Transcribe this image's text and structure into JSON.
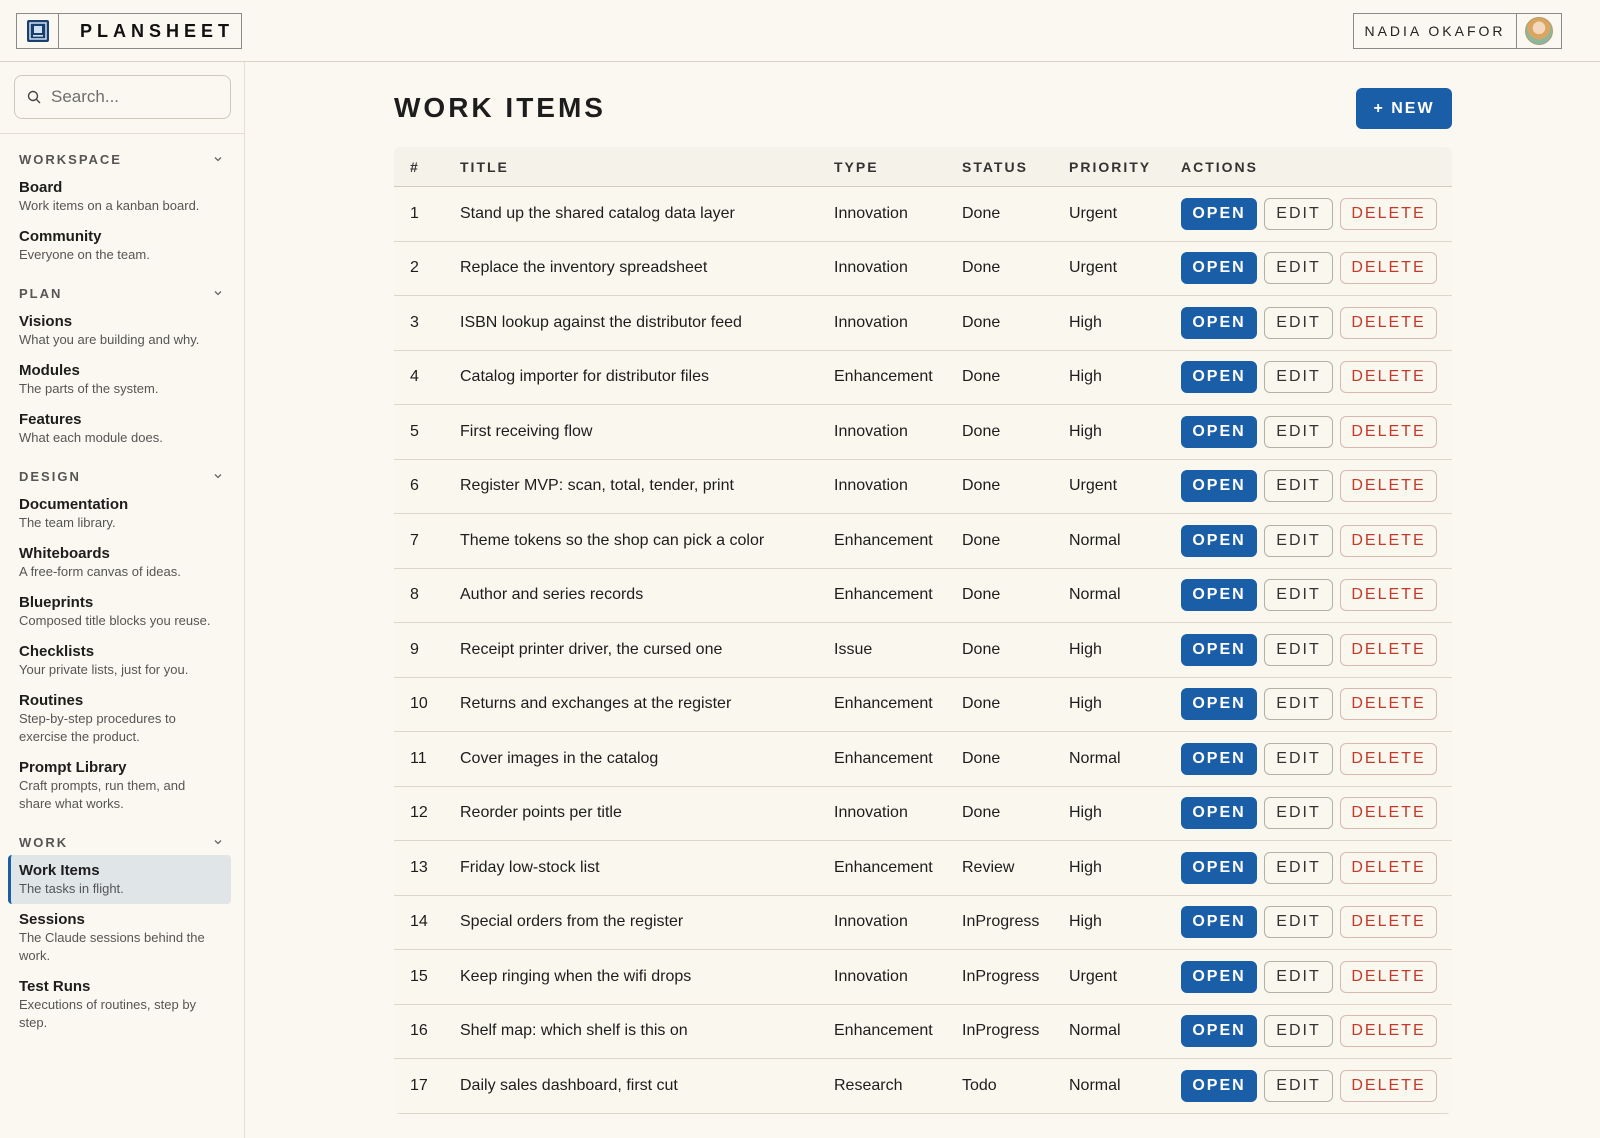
{
  "app": {
    "name": "PLANSHEET"
  },
  "user": {
    "name": "NADIA OKAFOR"
  },
  "search": {
    "placeholder": "Search..."
  },
  "sidebar": {
    "sections": [
      {
        "title": "WORKSPACE",
        "items": [
          {
            "label": "Board",
            "desc": "Work items on a kanban board."
          },
          {
            "label": "Community",
            "desc": "Everyone on the team."
          }
        ]
      },
      {
        "title": "PLAN",
        "items": [
          {
            "label": "Visions",
            "desc": "What you are building and why."
          },
          {
            "label": "Modules",
            "desc": "The parts of the system."
          },
          {
            "label": "Features",
            "desc": "What each module does."
          }
        ]
      },
      {
        "title": "DESIGN",
        "items": [
          {
            "label": "Documentation",
            "desc": "The team library."
          },
          {
            "label": "Whiteboards",
            "desc": "A free-form canvas of ideas."
          },
          {
            "label": "Blueprints",
            "desc": "Composed title blocks you reuse."
          },
          {
            "label": "Checklists",
            "desc": "Your private lists, just for you."
          },
          {
            "label": "Routines",
            "desc": "Step-by-step procedures to exercise the product."
          },
          {
            "label": "Prompt Library",
            "desc": "Craft prompts, run them, and share what works."
          }
        ]
      },
      {
        "title": "WORK",
        "items": [
          {
            "label": "Work Items",
            "desc": "The tasks in flight.",
            "active": true
          },
          {
            "label": "Sessions",
            "desc": "The Claude sessions behind the work."
          },
          {
            "label": "Test Runs",
            "desc": "Executions of routines, step by step."
          }
        ]
      }
    ]
  },
  "main": {
    "title": "WORK ITEMS",
    "new_label": "+ NEW",
    "columns": [
      "#",
      "TITLE",
      "TYPE",
      "STATUS",
      "PRIORITY",
      "ACTIONS"
    ],
    "actions": {
      "open": "OPEN",
      "edit": "EDIT",
      "delete": "DELETE"
    },
    "rows": [
      {
        "num": "1",
        "title": "Stand up the shared catalog data layer",
        "type": "Innovation",
        "status": "Done",
        "priority": "Urgent"
      },
      {
        "num": "2",
        "title": "Replace the inventory spreadsheet",
        "type": "Innovation",
        "status": "Done",
        "priority": "Urgent"
      },
      {
        "num": "3",
        "title": "ISBN lookup against the distributor feed",
        "type": "Innovation",
        "status": "Done",
        "priority": "High"
      },
      {
        "num": "4",
        "title": "Catalog importer for distributor files",
        "type": "Enhancement",
        "status": "Done",
        "priority": "High"
      },
      {
        "num": "5",
        "title": "First receiving flow",
        "type": "Innovation",
        "status": "Done",
        "priority": "High"
      },
      {
        "num": "6",
        "title": "Register MVP: scan, total, tender, print",
        "type": "Innovation",
        "status": "Done",
        "priority": "Urgent"
      },
      {
        "num": "7",
        "title": "Theme tokens so the shop can pick a color",
        "type": "Enhancement",
        "status": "Done",
        "priority": "Normal"
      },
      {
        "num": "8",
        "title": "Author and series records",
        "type": "Enhancement",
        "status": "Done",
        "priority": "Normal"
      },
      {
        "num": "9",
        "title": "Receipt printer driver, the cursed one",
        "type": "Issue",
        "status": "Done",
        "priority": "High"
      },
      {
        "num": "10",
        "title": "Returns and exchanges at the register",
        "type": "Enhancement",
        "status": "Done",
        "priority": "High"
      },
      {
        "num": "11",
        "title": "Cover images in the catalog",
        "type": "Enhancement",
        "status": "Done",
        "priority": "Normal"
      },
      {
        "num": "12",
        "title": "Reorder points per title",
        "type": "Innovation",
        "status": "Done",
        "priority": "High"
      },
      {
        "num": "13",
        "title": "Friday low-stock list",
        "type": "Enhancement",
        "status": "Review",
        "priority": "High"
      },
      {
        "num": "14",
        "title": "Special orders from the register",
        "type": "Innovation",
        "status": "InProgress",
        "priority": "High"
      },
      {
        "num": "15",
        "title": "Keep ringing when the wifi drops",
        "type": "Innovation",
        "status": "InProgress",
        "priority": "Urgent"
      },
      {
        "num": "16",
        "title": "Shelf map: which shelf is this on",
        "type": "Enhancement",
        "status": "InProgress",
        "priority": "Normal"
      },
      {
        "num": "17",
        "title": "Daily sales dashboard, first cut",
        "type": "Research",
        "status": "Todo",
        "priority": "Normal"
      }
    ]
  },
  "colors": {
    "accent": "#1a5ea8",
    "danger": "#c23a2b",
    "background": "#fbf8f1"
  },
  "icons": {
    "brand": "board-logo-icon",
    "search": "search-icon",
    "chevron": "chevron-down-icon",
    "avatar": "avatar"
  }
}
